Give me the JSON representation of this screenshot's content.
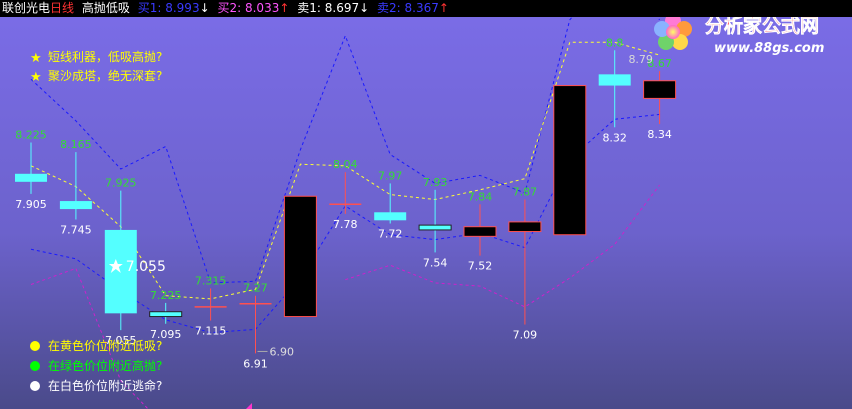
{
  "header": {
    "title": "联创光电",
    "period": "日线",
    "indicator": "高抛低吸",
    "buy1_label": "买1:",
    "buy1_value": "8.993",
    "buy1_arrow": "↓",
    "buy2_label": "买2:",
    "buy2_value": "8.033",
    "buy2_arrow": "↑",
    "sell1_label": "卖1:",
    "sell1_value": "8.697",
    "sell1_arrow": "↓",
    "sell2_label": "卖2:",
    "sell2_value": "8.367",
    "sell2_arrow": "↑"
  },
  "tips_top": [
    {
      "star": "★",
      "text": "短线利器，低吸高抛?"
    },
    {
      "star": "★",
      "text": "聚沙成塔，绝无深套?"
    }
  ],
  "legend_bottom": [
    {
      "text": "在黄色价位附近低吸?",
      "color": "#ffff00"
    },
    {
      "text": "在绿色价位附近高抛?",
      "color": "#00ff00"
    },
    {
      "text": "在白色价位附近逃命?",
      "color": "#ffffff"
    }
  ],
  "watermark": {
    "title": "分析家公式网",
    "url": "www.88gs.com"
  },
  "colors": {
    "up_candle_fill": "#000000",
    "up_candle_border": "#ff5050",
    "down_candle_fill": "#54ffff",
    "doji": "#ff5050",
    "high_label": "#33dd33",
    "low_label": "#ffffff",
    "blue_dashed": "#1a1aff",
    "yellow_dashed": "#ffff33",
    "magenta_dashed": "#cc22cc"
  },
  "chart_data": {
    "type": "candlestick",
    "ylim": [
      6.5,
      9.2
    ],
    "candles": [
      {
        "open": 8.03,
        "close": 7.98,
        "high": 8.225,
        "low": 7.905,
        "high_label": "8.225",
        "low_label": "7.905"
      },
      {
        "open": 7.86,
        "close": 7.81,
        "high": 8.165,
        "low": 7.745,
        "high_label": "8.165",
        "low_label": "7.745"
      },
      {
        "open": 7.68,
        "close": 7.16,
        "high": 7.925,
        "low": 7.055,
        "high_label": "7.925",
        "low_label": "7.055"
      },
      {
        "open": 7.17,
        "close": 7.14,
        "high": 7.225,
        "low": 7.095,
        "high_label": "7.225",
        "low_label": "7.095"
      },
      {
        "open": 7.2,
        "close": 7.2,
        "high": 7.315,
        "low": 7.115,
        "high_label": "7.315",
        "low_label": "7.115"
      },
      {
        "open": 7.22,
        "close": 7.22,
        "high": 7.27,
        "low": 6.91,
        "high_label": "7.27",
        "low_label": "6.91"
      },
      {
        "open": 7.14,
        "close": 7.89,
        "high": 7.89,
        "low": 7.14,
        "high_label": "",
        "low_label": ""
      },
      {
        "open": 7.84,
        "close": 7.84,
        "high": 8.04,
        "low": 7.78,
        "high_label": "8.04",
        "low_label": "7.78"
      },
      {
        "open": 7.79,
        "close": 7.74,
        "high": 7.97,
        "low": 7.72,
        "high_label": "7.97",
        "low_label": "7.72"
      },
      {
        "open": 7.71,
        "close": 7.68,
        "high": 7.93,
        "low": 7.54,
        "high_label": "7.93",
        "low_label": "7.54"
      },
      {
        "open": 7.64,
        "close": 7.7,
        "high": 7.84,
        "low": 7.52,
        "high_label": "7.84",
        "low_label": "7.52"
      },
      {
        "open": 7.67,
        "close": 7.73,
        "high": 7.87,
        "low": 7.09,
        "high_label": "7.87",
        "low_label": "7.09"
      },
      {
        "open": 7.65,
        "close": 8.58,
        "high": 8.58,
        "low": 7.65,
        "high_label": "",
        "low_label": ""
      },
      {
        "open": 8.65,
        "close": 8.58,
        "high": 8.8,
        "low": 8.32,
        "high_label": "8.8",
        "low_label": "8.32"
      },
      {
        "open": 8.5,
        "close": 8.61,
        "high": 8.67,
        "low": 8.34,
        "high_label": "8.67",
        "low_label": "8.34"
      }
    ],
    "marker": {
      "index": 2,
      "value": 7.055,
      "label": "7.055"
    },
    "low_marker": {
      "index": 5,
      "label": "6.90"
    },
    "extra_label": {
      "index": 13,
      "label": "8.79"
    },
    "blue_upper": [
      8.62,
      8.36,
      8.06,
      8.2,
      7.35,
      7.36,
      8.18,
      8.89,
      8.15,
      7.97,
      8.02,
      7.91,
      8.99,
      9.32,
      8.99
    ],
    "blue_lower": [
      7.56,
      7.5,
      7.3,
      7.12,
      7.04,
      7.06,
      7.38,
      7.83,
      7.65,
      7.62,
      7.66,
      7.57,
      8.12,
      8.37,
      8.4
    ],
    "yellow_mid": [
      8.08,
      7.95,
      7.7,
      7.27,
      7.25,
      7.31,
      8.09,
      8.08,
      7.9,
      7.87,
      7.93,
      8.0,
      8.85,
      8.85,
      8.77
    ],
    "magenta_low": [
      7.34,
      7.44,
      6.74,
      6.45,
      null,
      null,
      null,
      7.37,
      7.46,
      7.35,
      7.33,
      7.2,
      7.38,
      7.59,
      7.96
    ]
  }
}
